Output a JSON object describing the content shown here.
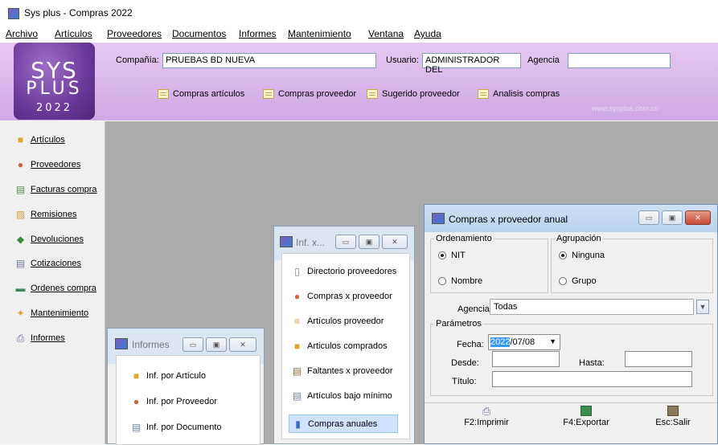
{
  "window": {
    "title": "Sys plus - Compras 2022"
  },
  "menu": [
    "Archivo",
    "Artículos",
    "Proveedores",
    "Documentos",
    "Informes",
    "Mantenimiento",
    "Ventana",
    "Ayuda"
  ],
  "logo": {
    "line1": "SYS",
    "line2": "PLUS",
    "line3": "2022"
  },
  "header": {
    "compania_label": "Compañía:",
    "compania_value": "PRUEBAS BD NUEVA",
    "usuario_label": "Usuario:",
    "usuario_value": "ADMINISTRADOR DEL",
    "agencia_label": "Agencia",
    "agencia_value": "",
    "website": "www.sysplus.com.co",
    "buttons": [
      "Compras artículos",
      "Compras proveedor",
      "Sugerido proveedor",
      "Analisis compras"
    ]
  },
  "sidebar": {
    "items": [
      {
        "label": "Artículos",
        "icon": "box-icon"
      },
      {
        "label": "Proveedores",
        "icon": "person-icon"
      },
      {
        "label": "Facturas compra",
        "icon": "invoice-icon"
      },
      {
        "label": "Remisiones",
        "icon": "remission-icon"
      },
      {
        "label": "Devoluciones",
        "icon": "return-icon"
      },
      {
        "label": "Cotizaciones",
        "icon": "quote-icon"
      },
      {
        "label": "Ordenes compra",
        "icon": "order-icon"
      },
      {
        "label": "Mantenimiento",
        "icon": "tools-icon"
      },
      {
        "label": "Informes",
        "icon": "printer-icon"
      }
    ]
  },
  "informes_window": {
    "title": "Informes",
    "items": [
      "Inf. por Artículo",
      "Inf. por Proveedor",
      "Inf. por Documento"
    ]
  },
  "infx_window": {
    "title": "Inf. x...",
    "items": [
      "Directorio proveedores",
      "Compras x proveedor",
      "Artículos proveedor",
      "Articulos comprados",
      "Faltantes x proveedor",
      "Artículos bajo mínimo",
      "Compras anuales"
    ],
    "selected": "Compras anuales"
  },
  "compras_window": {
    "title": "Compras x proveedor anual",
    "ordenamiento": {
      "legend": "Ordenamiento",
      "opt1": "NIT",
      "opt2": "Nombre",
      "selected": "NIT"
    },
    "agrupacion": {
      "legend": "Agrupación",
      "opt1": "Ninguna",
      "opt2": "Grupo",
      "selected": "Ninguna"
    },
    "agencia_label": "Agencia:",
    "agencia_value": "Todas",
    "parametros_legend": "Parámetros",
    "fecha_label": "Fecha:",
    "fecha_year": "2022",
    "fecha_rest": "/07/08",
    "desde_label": "Desde:",
    "hasta_label": "Hasta:",
    "titulo_label": "Título:",
    "buttons": {
      "imprimir": "F2:Imprimir",
      "exportar": "F4:Exportar",
      "salir": "Esc:Salir"
    }
  }
}
